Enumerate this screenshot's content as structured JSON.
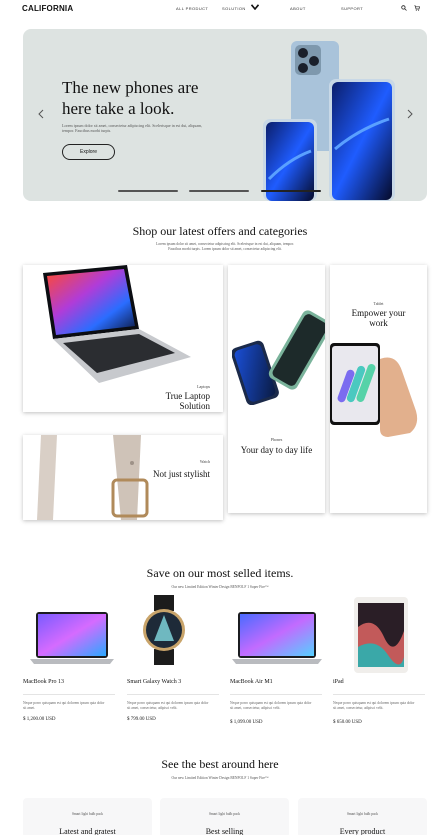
{
  "nav": {
    "logo": "CALIFORNIA",
    "links": [
      "ALL PRODUCT",
      "SOLUTION",
      "ABOUT",
      "SUPPORT"
    ],
    "icons": [
      "search-icon",
      "cart-icon",
      "chevron-down-icon"
    ]
  },
  "hero": {
    "title": "The new phones are here take a look.",
    "subtitle": "Lorem ipsum dolor sit amet, consectetur adipiscing elit. Scelerisque in est dui, aliquam, tempor. Faucibus morbi turpis.",
    "button": "Explore",
    "slides": 3,
    "active_slide": 3
  },
  "categories_section": {
    "title": "Shop our latest offers and categories",
    "subtitle": "Lorem ipsum dolor sit amet, consectetur adipiscing elit. Scelerisque in est dui, aliquam, tempor. Faucibus morbi turpis. Lorem ipsum dolor sit amet, consectetur adipiscing elit.",
    "cards": [
      {
        "kicker": "Laptops",
        "title": "True Laptop Solution"
      },
      {
        "kicker": "Watch",
        "title": "Not just stylisht"
      },
      {
        "kicker": "Phones",
        "title": "Your day to day life"
      },
      {
        "kicker": "Tablet",
        "title": "Empower your work"
      }
    ]
  },
  "products_section": {
    "title": "Save on our most selled items.",
    "subtitle": "Our new Limited Edition Winter Design BENFOLF 1 Super Fire™",
    "items": [
      {
        "name": "MacBook Pro 13",
        "desc": "Neque porro quisquam est qui dolorem ipsum quia dolor sit amet.",
        "price": "$ 1,200.00 USD"
      },
      {
        "name": "Smart Galaxy Watch 3",
        "desc": "Neque porro quisquam est qui dolorem ipsum quia dolor sit amet, consectetur, adipisci velit.",
        "price": "$ 799.00 USD"
      },
      {
        "name": "MacBook Air M1",
        "desc": "Neque porro quisquam est qui dolorem ipsum quia dolor sit amet, consectetur, adipisci velit.",
        "price": "$ 1,099.00 USD"
      },
      {
        "name": "iPad",
        "desc": "Neque porro quisquam est qui dolorem ipsum quia dolor sit amet, consectetur, adipisci velit.",
        "price": "$ 650.00 USD"
      }
    ]
  },
  "best_section": {
    "title": "See the best around here",
    "subtitle": "Our new Limited Edition Winter Design BENFOLF 1 Super Fire™",
    "cards": [
      {
        "kicker": "Smart light bulb pack",
        "title": "Latest and gratest"
      },
      {
        "kicker": "Smart light bulb pack",
        "title": "Best selling"
      },
      {
        "kicker": "Smart light bulb pack",
        "title": "Every product"
      }
    ]
  }
}
